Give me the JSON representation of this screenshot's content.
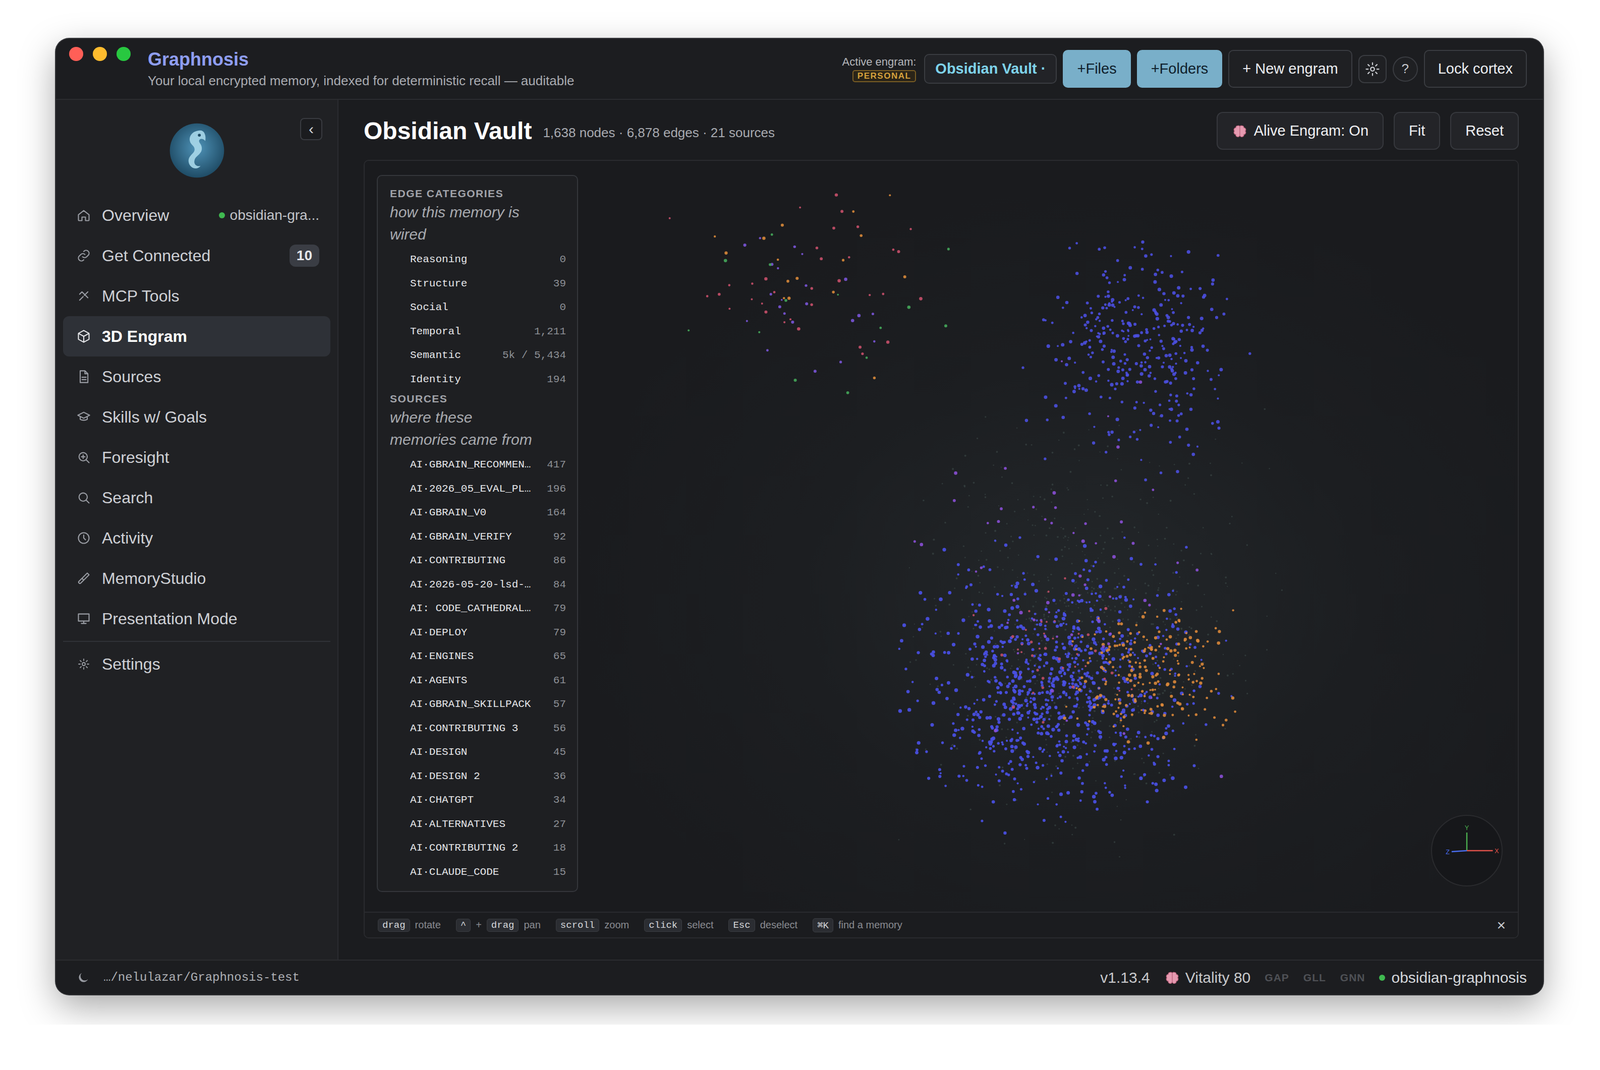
{
  "window": {
    "title": "Graphnosis",
    "subtitle": "Your local encrypted memory, indexed for deterministic recall — auditable",
    "traffic_lights": [
      {
        "color": "#ff5f57"
      },
      {
        "color": "#febc2e"
      },
      {
        "color": "#28c840"
      }
    ]
  },
  "titlebar": {
    "active_label": "Active engram:",
    "badge": "PERSONAL",
    "engram": "Obsidian Vault ·",
    "buttons": [
      {
        "kind": "primary",
        "label": "+Files"
      },
      {
        "kind": "primary",
        "label": "+Folders"
      },
      {
        "kind": "default",
        "label": "+ New engram"
      },
      {
        "kind": "gear",
        "label": ""
      },
      {
        "kind": "help",
        "label": "?"
      },
      {
        "kind": "default",
        "label": "Lock cortex"
      }
    ]
  },
  "sidebar": {
    "collapse": "‹",
    "items": [
      {
        "label": "Overview",
        "selected": false,
        "status": "obsidian-gra...",
        "status_color": "#3fb950",
        "badge": ""
      },
      {
        "label": "Get Connected",
        "selected": false,
        "status": "",
        "status_color": "",
        "badge": "10"
      },
      {
        "label": "MCP Tools",
        "selected": false,
        "status": "",
        "status_color": "",
        "badge": ""
      },
      {
        "label": "3D Engram",
        "selected": true,
        "status": "",
        "status_color": "",
        "badge": ""
      },
      {
        "label": "Sources",
        "selected": false,
        "status": "",
        "status_color": "",
        "badge": ""
      },
      {
        "label": "Skills w/ Goals",
        "selected": false,
        "status": "",
        "status_color": "",
        "badge": ""
      },
      {
        "label": "Foresight",
        "selected": false,
        "status": "",
        "status_color": "",
        "badge": ""
      },
      {
        "label": "Search",
        "selected": false,
        "status": "",
        "status_color": "",
        "badge": ""
      },
      {
        "label": "Activity",
        "selected": false,
        "status": "",
        "status_color": "",
        "badge": ""
      },
      {
        "label": "MemoryStudio",
        "selected": false,
        "status": "",
        "status_color": "",
        "badge": ""
      },
      {
        "label": "Presentation Mode",
        "selected": false,
        "status": "",
        "status_color": "",
        "badge": ""
      }
    ],
    "footer_items": [
      {
        "label": "Settings",
        "selected": false
      }
    ]
  },
  "main": {
    "title": "Obsidian Vault",
    "stats": "1,638 nodes · 6,878 edges · 21 sources",
    "buttons": [
      {
        "label": "Alive Engram: On",
        "kind": "alive"
      },
      {
        "label": "Fit",
        "kind": "plain"
      },
      {
        "label": "Reset",
        "kind": "plain"
      }
    ]
  },
  "legend": {
    "sections": [
      {
        "title": "EDGE CATEGORIES",
        "subtitle": "how this memory is wired",
        "rows": [
          {
            "name": "Reasoning",
            "count": "0"
          },
          {
            "name": "Structure",
            "count": "39"
          },
          {
            "name": "Social",
            "count": "0"
          },
          {
            "name": "Temporal",
            "count": "1,211"
          },
          {
            "name": "Semantic",
            "count": "5k / 5,434"
          },
          {
            "name": "Identity",
            "count": "194"
          }
        ]
      },
      {
        "title": "SOURCES",
        "subtitle": "where these memories came from",
        "rows": [
          {
            "name": "AI·GBRAIN_RECOMMEN…",
            "count": "417"
          },
          {
            "name": "AI·2026_05_EVAL_PL…",
            "count": "196"
          },
          {
            "name": "AI·GBRAIN_V0",
            "count": "164"
          },
          {
            "name": "AI·GBRAIN_VERIFY",
            "count": "92"
          },
          {
            "name": "AI·CONTRIBUTING",
            "count": "86"
          },
          {
            "name": "AI·2026-05-20-lsd-…",
            "count": "84"
          },
          {
            "name": "AI: CODE_CATHEDRAL…",
            "count": "79"
          },
          {
            "name": "AI·DEPLOY",
            "count": "79"
          },
          {
            "name": "AI·ENGINES",
            "count": "65"
          },
          {
            "name": "AI·AGENTS",
            "count": "61"
          },
          {
            "name": "AI·GBRAIN_SKILLPACK",
            "count": "57"
          },
          {
            "name": "AI·CONTRIBUTING 3",
            "count": "56"
          },
          {
            "name": "AI·DESIGN",
            "count": "45"
          },
          {
            "name": "AI·DESIGN 2",
            "count": "36"
          },
          {
            "name": "AI·CHATGPT",
            "count": "34"
          },
          {
            "name": "AI·ALTERNATIVES",
            "count": "27"
          },
          {
            "name": "AI·CONTRIBUTING 2",
            "count": "18"
          },
          {
            "name": "AI·CLAUDE_CODE",
            "count": "15"
          }
        ]
      }
    ]
  },
  "graph": {
    "clusters": [
      {
        "x": 0.62,
        "y": 0.62,
        "sx": 0.2,
        "sy": 0.36,
        "count": 600,
        "color": "#3f4f4c",
        "size": 1.6,
        "opacity": 0.55
      },
      {
        "x": 0.38,
        "y": 0.17,
        "sx": 0.14,
        "sy": 0.17,
        "count": 34,
        "color": "#c9506a",
        "size": 2.6,
        "opacity": 0.9
      },
      {
        "x": 0.38,
        "y": 0.17,
        "sx": 0.14,
        "sy": 0.17,
        "count": 16,
        "color": "#d98a3a",
        "size": 2.6,
        "opacity": 0.9
      },
      {
        "x": 0.38,
        "y": 0.18,
        "sx": 0.14,
        "sy": 0.17,
        "count": 22,
        "color": "#7a55d8",
        "size": 2.6,
        "opacity": 0.9
      },
      {
        "x": 0.4,
        "y": 0.22,
        "sx": 0.16,
        "sy": 0.2,
        "count": 14,
        "color": "#45a85a",
        "size": 2.6,
        "opacity": 0.9
      },
      {
        "x": 0.67,
        "y": 0.25,
        "sx": 0.11,
        "sy": 0.2,
        "count": 340,
        "color": "#4b4fe0",
        "size": 2.8,
        "opacity": 0.9
      },
      {
        "x": 0.6,
        "y": 0.7,
        "sx": 0.17,
        "sy": 0.22,
        "count": 880,
        "color": "#4a50e6",
        "size": 2.9,
        "opacity": 0.92
      },
      {
        "x": 0.68,
        "y": 0.68,
        "sx": 0.1,
        "sy": 0.12,
        "count": 220,
        "color": "#d9873a",
        "size": 2.6,
        "opacity": 0.9
      },
      {
        "x": 0.6,
        "y": 0.55,
        "sx": 0.18,
        "sy": 0.35,
        "count": 60,
        "color": "#8a4fd6",
        "size": 2.8,
        "opacity": 0.9
      },
      {
        "x": 0.6,
        "y": 0.66,
        "sx": 0.1,
        "sy": 0.12,
        "count": 40,
        "color": "#c9506a",
        "size": 2.4,
        "opacity": 0.85
      }
    ],
    "axes": [
      {
        "label": "Y",
        "color": "#4caf50"
      },
      {
        "label": "X",
        "color": "#e0524a"
      },
      {
        "label": "Z",
        "color": "#4a6ef0"
      }
    ]
  },
  "hints": {
    "items": [
      {
        "parts": [
          {
            "kind": "key",
            "text": "drag"
          },
          {
            "kind": "text",
            "text": "rotate"
          }
        ]
      },
      {
        "parts": [
          {
            "kind": "key",
            "text": "^"
          },
          {
            "kind": "text",
            "text": "+"
          },
          {
            "kind": "key",
            "text": "drag"
          },
          {
            "kind": "text",
            "text": "pan"
          }
        ]
      },
      {
        "parts": [
          {
            "kind": "key",
            "text": "scroll"
          },
          {
            "kind": "text",
            "text": "zoom"
          }
        ]
      },
      {
        "parts": [
          {
            "kind": "key",
            "text": "click"
          },
          {
            "kind": "text",
            "text": "select"
          }
        ]
      },
      {
        "parts": [
          {
            "kind": "key",
            "text": "Esc"
          },
          {
            "kind": "text",
            "text": "deselect"
          }
        ]
      },
      {
        "parts": [
          {
            "kind": "key",
            "text": "⌘K"
          },
          {
            "kind": "text",
            "text": "find a memory"
          }
        ]
      }
    ],
    "close": "×"
  },
  "status_bar": {
    "path": "…/nelulazar/Graphnosis-test",
    "version": "v1.13.4",
    "vitality": "Vitality 80",
    "flags": [
      {
        "label": "GAP",
        "on": false
      },
      {
        "label": "GLL",
        "on": false
      },
      {
        "label": "GNN",
        "on": false
      }
    ],
    "engram": "obsidian-graphnosis",
    "engram_color": "#3fb950"
  }
}
